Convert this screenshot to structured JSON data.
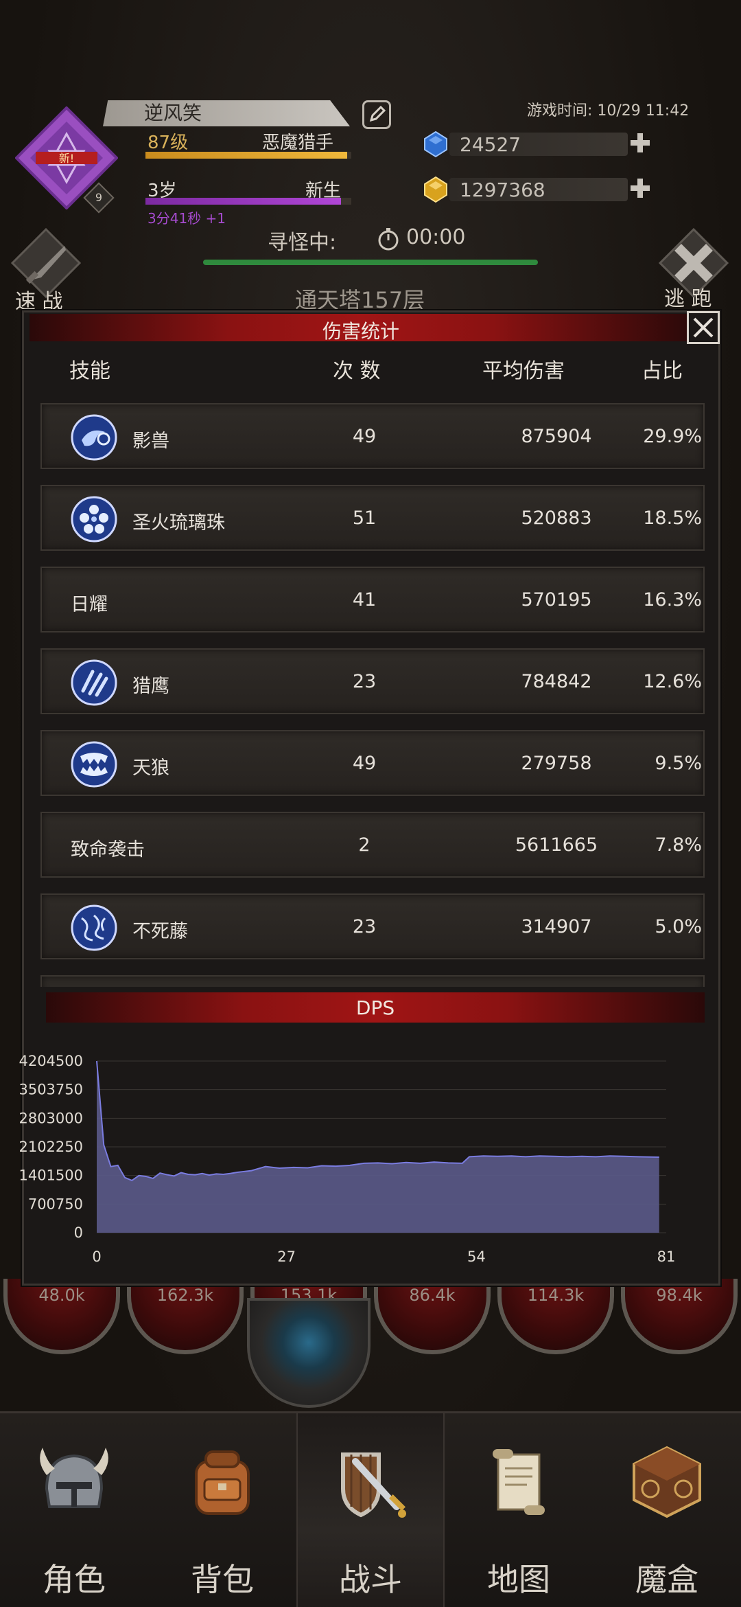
{
  "player": {
    "name": "逆风笑",
    "level": "87级",
    "class": "恶魔猎手",
    "age": "3岁",
    "age_status": "新生",
    "age_timer": "3分41秒 +1",
    "emblem_label": "新!",
    "badge_level": "9",
    "xp_progress": 0.98,
    "age_progress": 0.95
  },
  "game_time": "游戏时间: 10/29 11:42",
  "currencies": [
    {
      "name": "diamond",
      "value": "24527",
      "icon": "blue-gem-icon"
    },
    {
      "name": "gold",
      "value": "1297368",
      "icon": "gold-gem-icon"
    }
  ],
  "search": {
    "label": "寻怪中:",
    "timer": "00:00"
  },
  "actions": {
    "quick_battle": "速 战",
    "flee": "逃 跑"
  },
  "floor": "通天塔157层",
  "modal": {
    "title": "伤害统计",
    "columns": {
      "skill": "技能",
      "count": "次 数",
      "avg": "平均伤害",
      "pct": "占比"
    },
    "rows": [
      {
        "skill": "影兽",
        "count": "49",
        "avg": "875904",
        "pct": "29.9%",
        "icon": "shadow-beast-icon"
      },
      {
        "skill": "圣火琉璃珠",
        "count": "51",
        "avg": "520883",
        "pct": "18.5%",
        "icon": "holy-fire-orb-icon"
      },
      {
        "skill": "日耀",
        "count": "41",
        "avg": "570195",
        "pct": "16.3%",
        "icon": ""
      },
      {
        "skill": "猎鹰",
        "count": "23",
        "avg": "784842",
        "pct": "12.6%",
        "icon": "falcon-icon"
      },
      {
        "skill": "天狼",
        "count": "49",
        "avg": "279758",
        "pct": "9.5%",
        "icon": "sky-wolf-icon"
      },
      {
        "skill": "致命袭击",
        "count": "2",
        "avg": "5611665",
        "pct": "7.8%",
        "icon": ""
      },
      {
        "skill": "不死藤",
        "count": "23",
        "avg": "314907",
        "pct": "5.0%",
        "icon": "undying-vine-icon"
      }
    ],
    "dps_title": "DPS"
  },
  "chart_data": {
    "type": "area",
    "title": "DPS",
    "xlabel": "",
    "ylabel": "",
    "xlim": [
      0,
      81
    ],
    "ylim": [
      0,
      4204500
    ],
    "xticks": [
      "0",
      "27",
      "54",
      "81"
    ],
    "yticks": [
      "4204500",
      "3503750",
      "2803000",
      "2102250",
      "1401500",
      "700750",
      "0"
    ],
    "x": [
      0,
      1,
      2,
      3,
      4,
      5,
      6,
      7,
      8,
      9,
      10,
      11,
      12,
      13,
      14,
      15,
      16,
      17,
      18,
      19,
      20,
      21,
      22,
      24,
      26,
      28,
      30,
      32,
      34,
      36,
      38,
      40,
      42,
      44,
      46,
      48,
      50,
      52,
      53,
      55,
      57,
      59,
      61,
      63,
      65,
      67,
      69,
      71,
      73,
      75,
      77,
      80
    ],
    "values": [
      4204500,
      2150000,
      1620000,
      1650000,
      1350000,
      1280000,
      1400000,
      1380000,
      1330000,
      1460000,
      1420000,
      1390000,
      1470000,
      1430000,
      1420000,
      1450000,
      1410000,
      1440000,
      1430000,
      1450000,
      1480000,
      1500000,
      1520000,
      1620000,
      1580000,
      1600000,
      1590000,
      1640000,
      1630000,
      1650000,
      1700000,
      1710000,
      1690000,
      1720000,
      1700000,
      1730000,
      1710000,
      1700000,
      1860000,
      1880000,
      1870000,
      1880000,
      1860000,
      1880000,
      1870000,
      1860000,
      1870000,
      1860000,
      1880000,
      1870000,
      1860000,
      1850000
    ],
    "fill_color": "#5b5a8a",
    "line_color": "#7a7ce0",
    "grid": true
  },
  "battle_stats": [
    "48.0k",
    "162.3k",
    "153.1k",
    "86.4k",
    "114.3k",
    "98.4k"
  ],
  "nav": [
    {
      "label": "角色",
      "icon": "helmet-icon",
      "active": false
    },
    {
      "label": "背包",
      "icon": "backpack-icon",
      "active": false
    },
    {
      "label": "战斗",
      "icon": "sword-shield-icon",
      "active": true
    },
    {
      "label": "地图",
      "icon": "scroll-map-icon",
      "active": false
    },
    {
      "label": "魔盒",
      "icon": "magic-box-icon",
      "active": false
    }
  ]
}
